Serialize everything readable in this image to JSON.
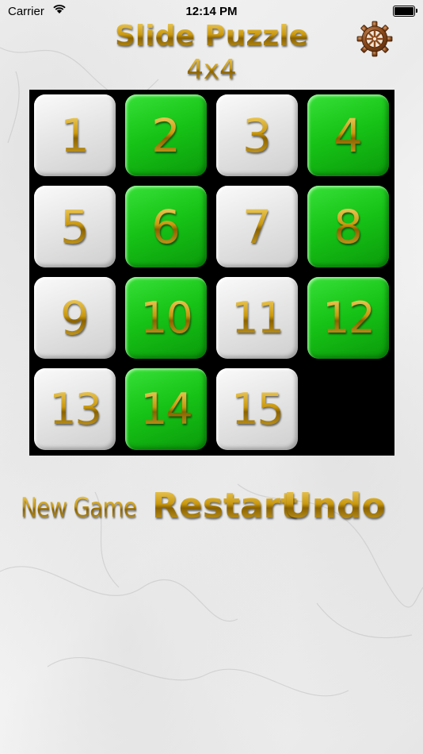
{
  "status_bar": {
    "carrier": "Carrier",
    "time": "12:14 PM",
    "battery_level": 1.0
  },
  "header": {
    "title": "Slide Puzzle",
    "subtitle": "4x4",
    "settings_icon": "gear-icon"
  },
  "board": {
    "rows": 4,
    "cols": 4,
    "tiles": [
      {
        "label": "1",
        "color": "light"
      },
      {
        "label": "2",
        "color": "green"
      },
      {
        "label": "3",
        "color": "light"
      },
      {
        "label": "4",
        "color": "green"
      },
      {
        "label": "5",
        "color": "light"
      },
      {
        "label": "6",
        "color": "green"
      },
      {
        "label": "7",
        "color": "light"
      },
      {
        "label": "8",
        "color": "green"
      },
      {
        "label": "9",
        "color": "light"
      },
      {
        "label": "10",
        "color": "green"
      },
      {
        "label": "11",
        "color": "light"
      },
      {
        "label": "12",
        "color": "green"
      },
      {
        "label": "13",
        "color": "light"
      },
      {
        "label": "14",
        "color": "green"
      },
      {
        "label": "15",
        "color": "light"
      },
      null
    ]
  },
  "actions": {
    "new_game": "New Game",
    "restart": "Restart",
    "undo": "Undo"
  },
  "colors": {
    "board": "#000000",
    "tile_light": "#e6e6e6",
    "tile_green": "#17c417",
    "gold": "#c9980f"
  }
}
